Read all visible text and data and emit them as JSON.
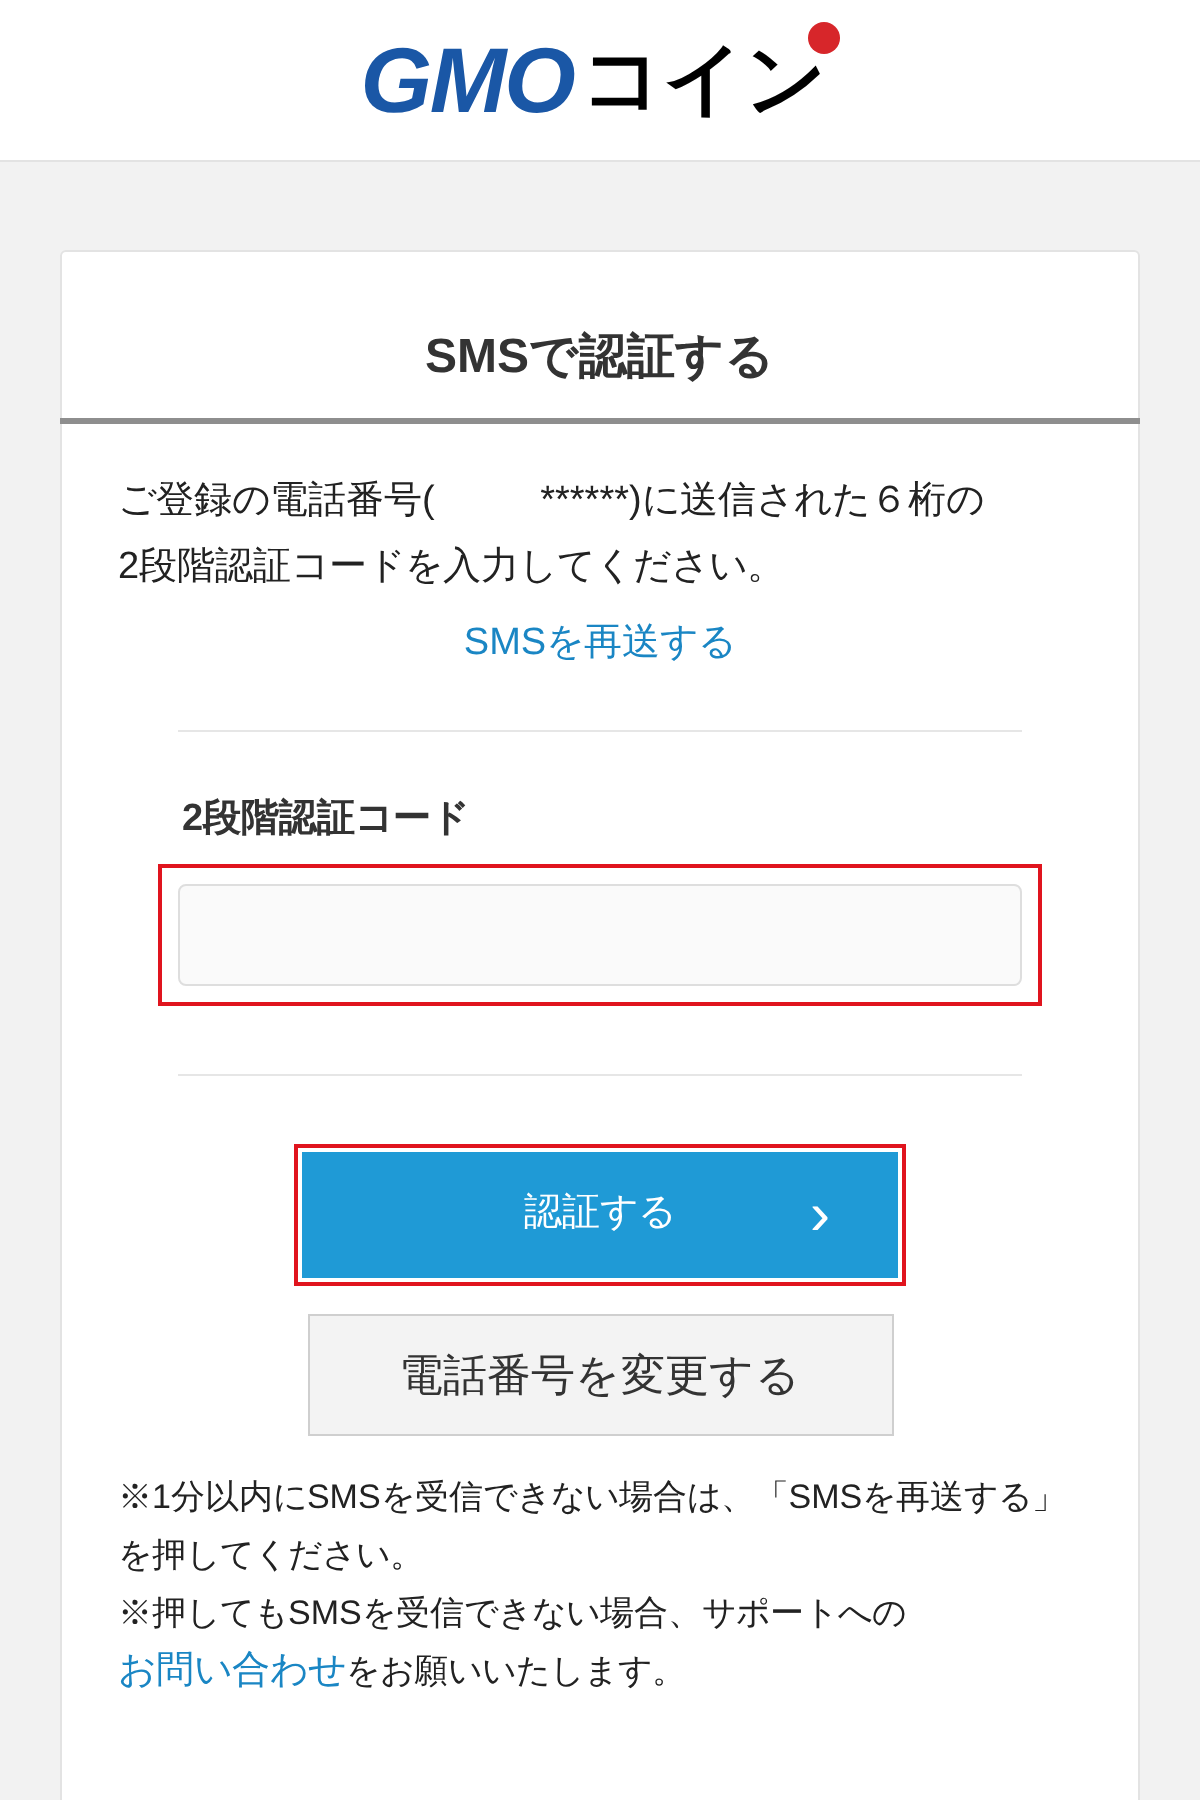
{
  "logo": {
    "brand": "GMO",
    "product": "コイン"
  },
  "card": {
    "title": "SMSで認証する",
    "instruction": "ご登録の電話番号(          ******)に送信された６桁の\n2段階認証コードを入力してください。",
    "resend_link": "SMSを再送する",
    "code_field": {
      "label": "2段階認証コード",
      "highlighted": true
    },
    "submit_button": {
      "label": "認証する",
      "chevron": "›",
      "highlighted": true
    },
    "change_phone_button": {
      "label": "電話番号を変更する"
    },
    "notes": [
      {
        "before": "※1分以内にSMSを受信できない場合は、「SMSを再送する」を押してください。"
      },
      {
        "before": "※押してもSMSを受信できない場合、サポートへの",
        "link": "お問い合わせ",
        "after": "をお願いいたします。"
      }
    ]
  }
}
